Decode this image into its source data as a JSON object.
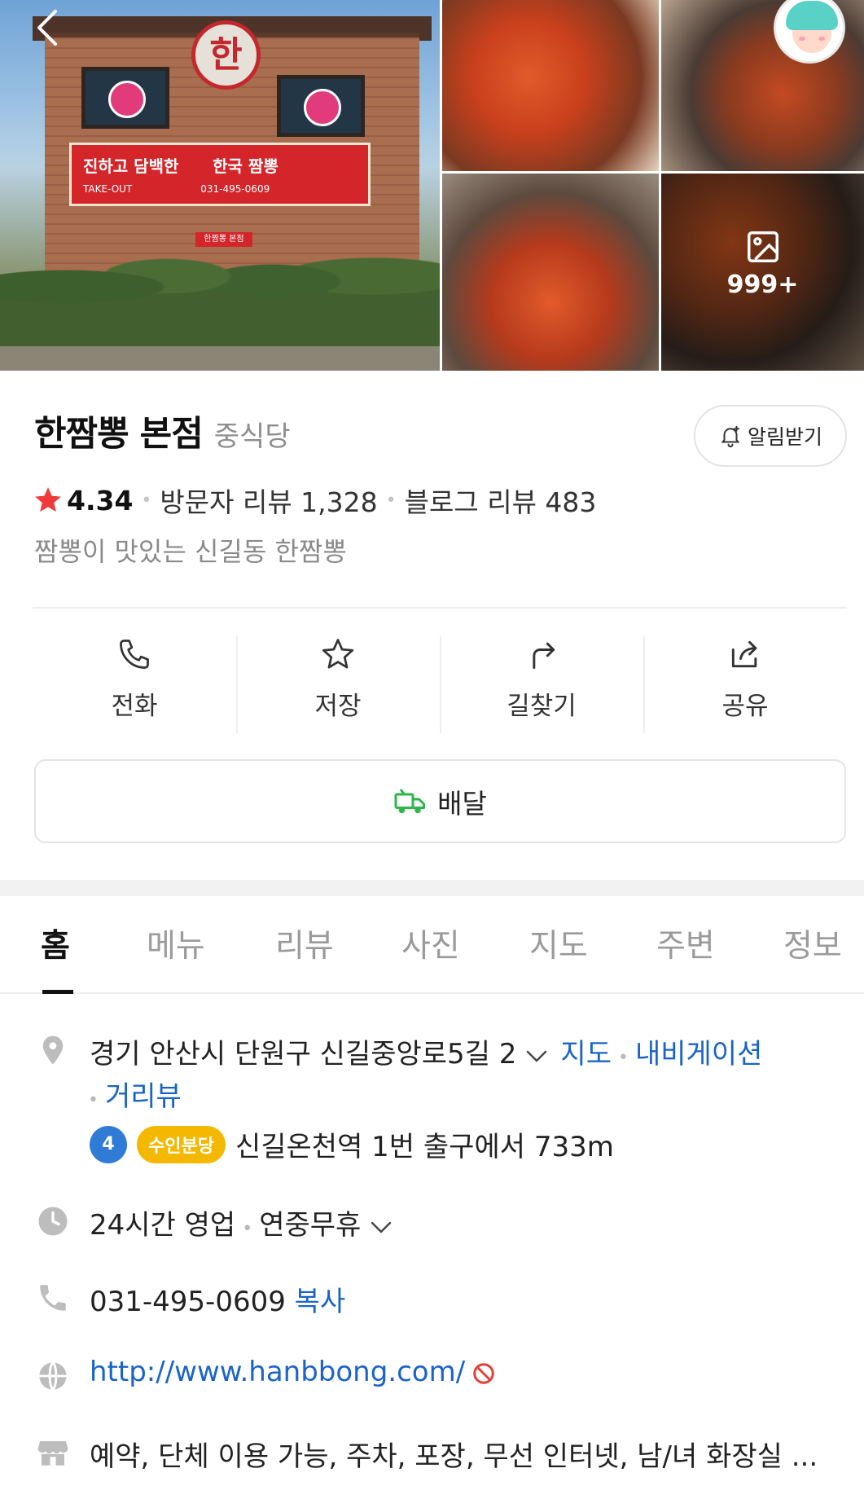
{
  "photos": {
    "more_count": "999+"
  },
  "place": {
    "name": "한짬뽕 본점",
    "category": "중식당",
    "alarm_label": "알림받기",
    "rating": "4.34",
    "visitor_review_label": "방문자 리뷰 1,328",
    "blog_review_label": "블로그 리뷰 483",
    "description": "짬뽕이 맛있는 신길동 한짬뽕"
  },
  "actions": [
    {
      "label": "전화",
      "icon": "phone-icon"
    },
    {
      "label": "저장",
      "icon": "star-outline-icon"
    },
    {
      "label": "길찾기",
      "icon": "directions-icon"
    },
    {
      "label": "공유",
      "icon": "share-icon"
    }
  ],
  "delivery": {
    "label": "배달",
    "icon": "delivery-truck-icon"
  },
  "tabs": [
    "홈",
    "메뉴",
    "리뷰",
    "사진",
    "지도",
    "주변",
    "정보"
  ],
  "active_tab": "홈",
  "details": {
    "address": "경기 안산시 단원구 신길중앙로5길 2",
    "map_link": "지도",
    "navi_link": "내비게이션",
    "roadview_link": "거리뷰",
    "subway_line_number": "4",
    "subway_line_name": "수인분당",
    "subway_text": "신길온천역 1번 출구에서 733m",
    "hours_main": "24시간 영업",
    "hours_sub": "연중무휴",
    "phone": "031-495-0609",
    "copy_label": "복사",
    "website": "http://www.hanbbong.com/",
    "amenities": "예약, 단체 이용 가능, 주차, 포장, 무선 인터넷, 남/녀 화장실 ..."
  },
  "storefront_sign": {
    "slogan_left": "진하고 담백한",
    "slogan_right": "한국 짬뽕",
    "phone": "031-495-0609",
    "takeout": "TAKE-OUT",
    "door": "한짬뽕 본점",
    "logo": "한"
  },
  "colors": {
    "link": "#1a64c8",
    "star": "#f03a3a",
    "line4": "#2f7bd6",
    "suin_bundang": "#f4b800",
    "delivery_icon": "#2fb54a"
  }
}
